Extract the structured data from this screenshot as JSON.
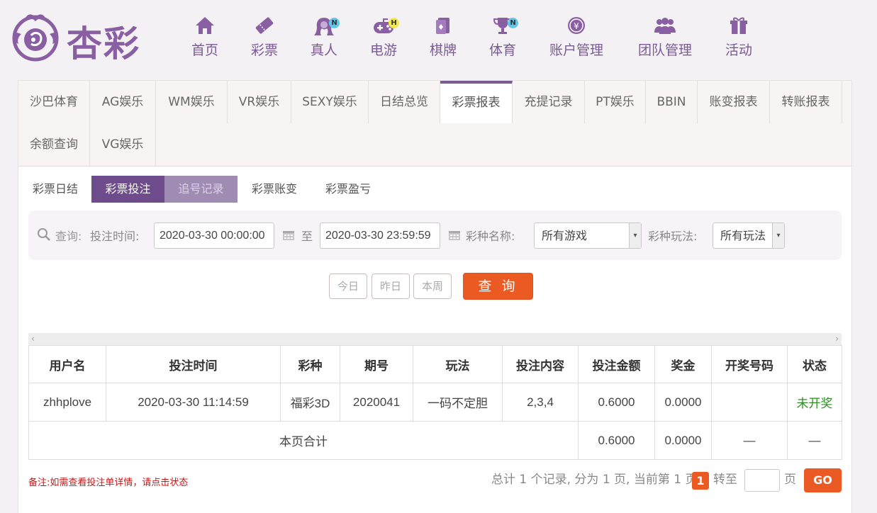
{
  "brand": {
    "name": "杏彩",
    "accent": "#7b5a96",
    "orange": "#ec5a24"
  },
  "nav": [
    {
      "label": "首页",
      "icon": "home-icon"
    },
    {
      "label": "彩票",
      "icon": "lottery-ticket-icon"
    },
    {
      "label": "真人",
      "icon": "live-dealer-icon",
      "badge": "N"
    },
    {
      "label": "电游",
      "icon": "gamepad-icon",
      "badge": "H"
    },
    {
      "label": "棋牌",
      "icon": "cards-icon"
    },
    {
      "label": "体育",
      "icon": "trophy-icon",
      "badge": "N"
    },
    {
      "label": "账户管理",
      "icon": "yuan-coin-icon"
    },
    {
      "label": "团队管理",
      "icon": "team-icon"
    },
    {
      "label": "活动",
      "icon": "gift-icon"
    }
  ],
  "tabs": [
    "沙巴体育",
    "AG娱乐",
    "WM娱乐",
    "VR娱乐",
    "SEXY娱乐",
    "日结总览",
    "彩票报表",
    "充提记录",
    "PT娱乐",
    "BBIN",
    "账变报表",
    "转账报表",
    "余额查询",
    "VG娱乐"
  ],
  "active_tab": "彩票报表",
  "subtabs": [
    "彩票日结",
    "彩票投注",
    "追号记录",
    "彩票账变",
    "彩票盈亏"
  ],
  "active_subtab": "彩票投注",
  "filter": {
    "query_label": "查询:",
    "time_label": "投注时间:",
    "start": "2020-03-30 00:00:00",
    "to": "至",
    "end": "2020-03-30 23:59:59",
    "game_label": "彩种名称:",
    "game_value": "所有游戏",
    "play_label": "彩种玩法:",
    "play_value": "所有玩法"
  },
  "quick": {
    "today": "今日",
    "yesterday": "昨日",
    "week": "本周",
    "search": "查 询"
  },
  "table": {
    "headers": [
      "用户名",
      "投注时间",
      "彩种",
      "期号",
      "玩法",
      "投注内容",
      "投注金额",
      "奖金",
      "开奖号码",
      "状态"
    ],
    "rows": [
      [
        "zhhplove",
        "2020-03-30 11:14:59",
        "福彩3D",
        "2020041",
        "一码不定胆",
        "2,3,4",
        "0.6000",
        "0.0000",
        "",
        "未开奖"
      ]
    ],
    "total": {
      "label": "本页合计",
      "amount": "0.6000",
      "bonus": "0.0000",
      "numbers": "—",
      "status": "—"
    }
  },
  "scroll": {
    "left": "‹",
    "right": "›"
  },
  "note": "备注:如需查看投注单详情，请点击状态",
  "pager": {
    "summary": "总计 1 个记录, 分为 1 页, 当前第 1 页",
    "current": "1",
    "goto": "转至",
    "page": "页",
    "go": "GO"
  }
}
